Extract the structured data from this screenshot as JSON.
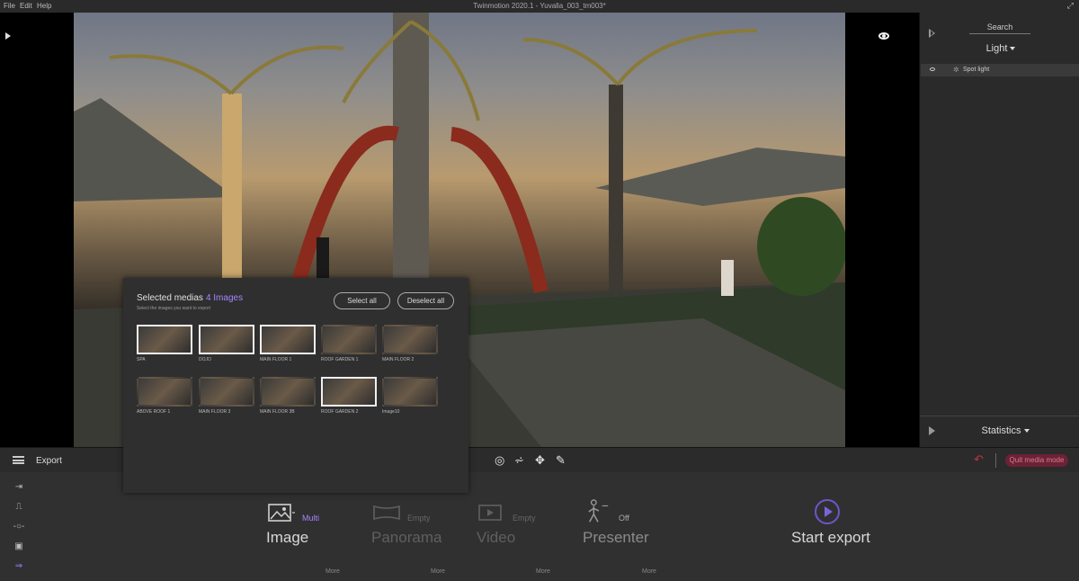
{
  "menubar": {
    "menus": [
      "File",
      "Edit",
      "Help"
    ],
    "title": "Twinmotion 2020.1 - Yuvalla_003_tm003*",
    "resize_icon": "expand-icon"
  },
  "right_panel": {
    "search_label": "Search",
    "category": "Light",
    "items": [
      {
        "label": "Spot light",
        "icon": "spotlight-icon"
      }
    ],
    "statistics_label": "Statistics"
  },
  "toolbar": {
    "mode_label": "Export",
    "tools": [
      "select-icon",
      "measure-icon",
      "move-icon",
      "pen-icon"
    ],
    "quit_label": "Quit media mode",
    "accent_color": "#6b2236"
  },
  "export_panel": {
    "sidebar_icons": [
      "import-icon",
      "path-icon",
      "settings-icon",
      "video-icon",
      "export-icon"
    ],
    "modes": [
      {
        "name": "Image",
        "badge": "Multi",
        "more": "More",
        "active": true
      },
      {
        "name": "Panorama",
        "badge": "Empty",
        "more": "More",
        "active": false
      },
      {
        "name": "Video",
        "badge": "Empty",
        "more": "More",
        "active": false
      },
      {
        "name": "Presenter",
        "badge": "Off",
        "more": "More",
        "active": false
      }
    ],
    "start_export_label": "Start export",
    "accent_color": "#9c7cff"
  },
  "media_popup": {
    "title": "Selected medias",
    "count": "4 Images",
    "subtitle": "Select the images you want to export",
    "select_all": "Select all",
    "deselect_all": "Deselect all",
    "images": [
      {
        "label": "SPA",
        "selected": true
      },
      {
        "label": "DOJO",
        "selected": true
      },
      {
        "label": "MAIN FLOOR 1",
        "selected": true
      },
      {
        "label": "ROOF GARDEN 1",
        "selected": false
      },
      {
        "label": "MAIN FLOOR 2",
        "selected": false
      },
      {
        "label": "ABOVE ROOF 1",
        "selected": false
      },
      {
        "label": "MAIN FLOOR 3",
        "selected": false
      },
      {
        "label": "MAIN FLOOR 3B",
        "selected": false
      },
      {
        "label": "ROOF GARDEN 2",
        "selected": true
      },
      {
        "label": "Image10",
        "selected": false
      }
    ]
  }
}
